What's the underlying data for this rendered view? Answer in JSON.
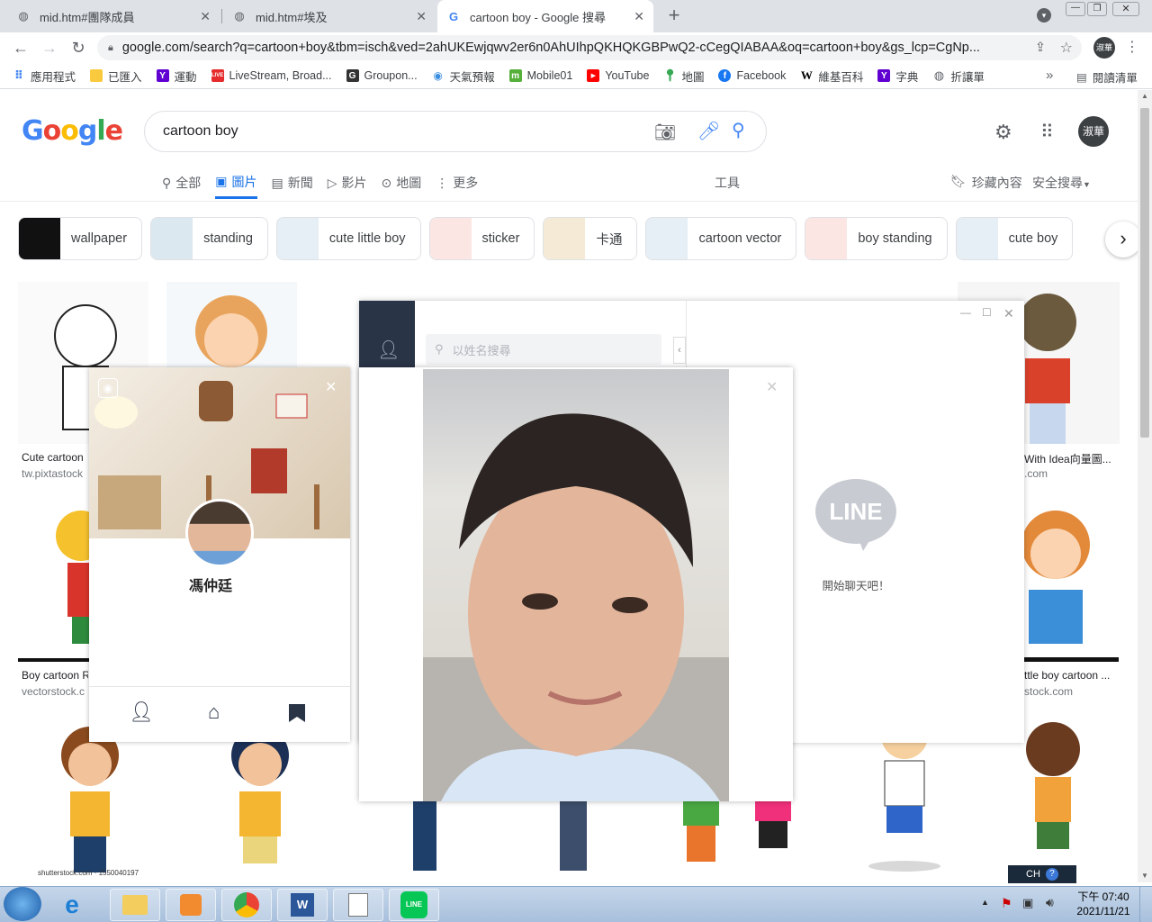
{
  "tabs": [
    {
      "title": "mid.htm#團隊成員",
      "active": false
    },
    {
      "title": "mid.htm#埃及",
      "active": false
    },
    {
      "title": "cartoon boy - Google 搜尋",
      "active": true
    }
  ],
  "address": {
    "url": "google.com/search?q=cartoon+boy&tbm=isch&ved=2ahUKEwjqwv2er6n0AhUIhpQKHQKGBPwQ2-cCegQIABAA&oq=cartoon+boy&gs_lcp=CgNp..."
  },
  "bookmarks": [
    {
      "label": "應用程式",
      "icon": "apps-grid-icon",
      "color": "#4285f4"
    },
    {
      "label": "已匯入",
      "icon": "folder-icon",
      "color": "#f9ca3d"
    },
    {
      "label": "運動",
      "icon": "yahoo-icon",
      "color": "#6001d2"
    },
    {
      "label": "LiveStream, Broad...",
      "icon": "line-live-icon",
      "color": "#e52b2b"
    },
    {
      "label": "Groupon...",
      "icon": "groupon-icon",
      "color": "#333333"
    },
    {
      "label": "天氣預報",
      "icon": "weather-icon",
      "color": "#3c8ee0"
    },
    {
      "label": "Mobile01",
      "icon": "mobile01-icon",
      "color": "#55b03a"
    },
    {
      "label": "YouTube",
      "icon": "youtube-icon",
      "color": "#ff0000"
    },
    {
      "label": "地圖",
      "icon": "maps-pin-icon",
      "color": "#34a853"
    },
    {
      "label": "Facebook",
      "icon": "facebook-icon",
      "color": "#1877f2"
    },
    {
      "label": "維基百科",
      "icon": "wikipedia-icon",
      "color": "#000000"
    },
    {
      "label": "字典",
      "icon": "yahoo-dict-icon",
      "color": "#6001d2"
    },
    {
      "label": "折讓單",
      "icon": "globe-icon",
      "color": "#5f6368"
    }
  ],
  "bookmarks_more": "»",
  "reading_list": "閱讀清單",
  "google": {
    "query": "cartoon boy",
    "avatar_text": "淑華",
    "menu": [
      {
        "label": "全部",
        "icon": "search-icon",
        "active": false
      },
      {
        "label": "圖片",
        "icon": "image-icon",
        "active": true
      },
      {
        "label": "新聞",
        "icon": "news-icon",
        "active": false
      },
      {
        "label": "影片",
        "icon": "video-icon",
        "active": false
      },
      {
        "label": "地圖",
        "icon": "map-pin-icon",
        "active": false
      },
      {
        "label": "更多",
        "icon": "more-vert-icon",
        "active": false
      }
    ],
    "tools": "工具",
    "saved": "珍藏內容",
    "safe_search": "安全搜尋"
  },
  "chips": [
    "wallpaper",
    "standing",
    "cute little boy",
    "sticker",
    "卡通",
    "cartoon vector",
    "boy standing",
    "cute boy"
  ],
  "results": [
    {
      "caption": "Cute cartoon",
      "source": "tw.pixtastock"
    },
    {
      "caption": "With Idea向量圖...",
      "source": ".com"
    },
    {
      "caption": "Boy cartoon R",
      "source": "vectorstock.c"
    },
    {
      "caption": "ttle boy cartoon ...",
      "source": "stock.com"
    }
  ],
  "watermark": "shutterstock.com · 1550040197",
  "line": {
    "search_placeholder": "以姓名搜尋",
    "profile_name": "馮仲廷",
    "empty_chat": "開始聊天吧！",
    "logo_text": "LINE"
  },
  "taskbar": {
    "ime": "CH",
    "time": "下午 07:40",
    "date": "2021/11/21"
  }
}
